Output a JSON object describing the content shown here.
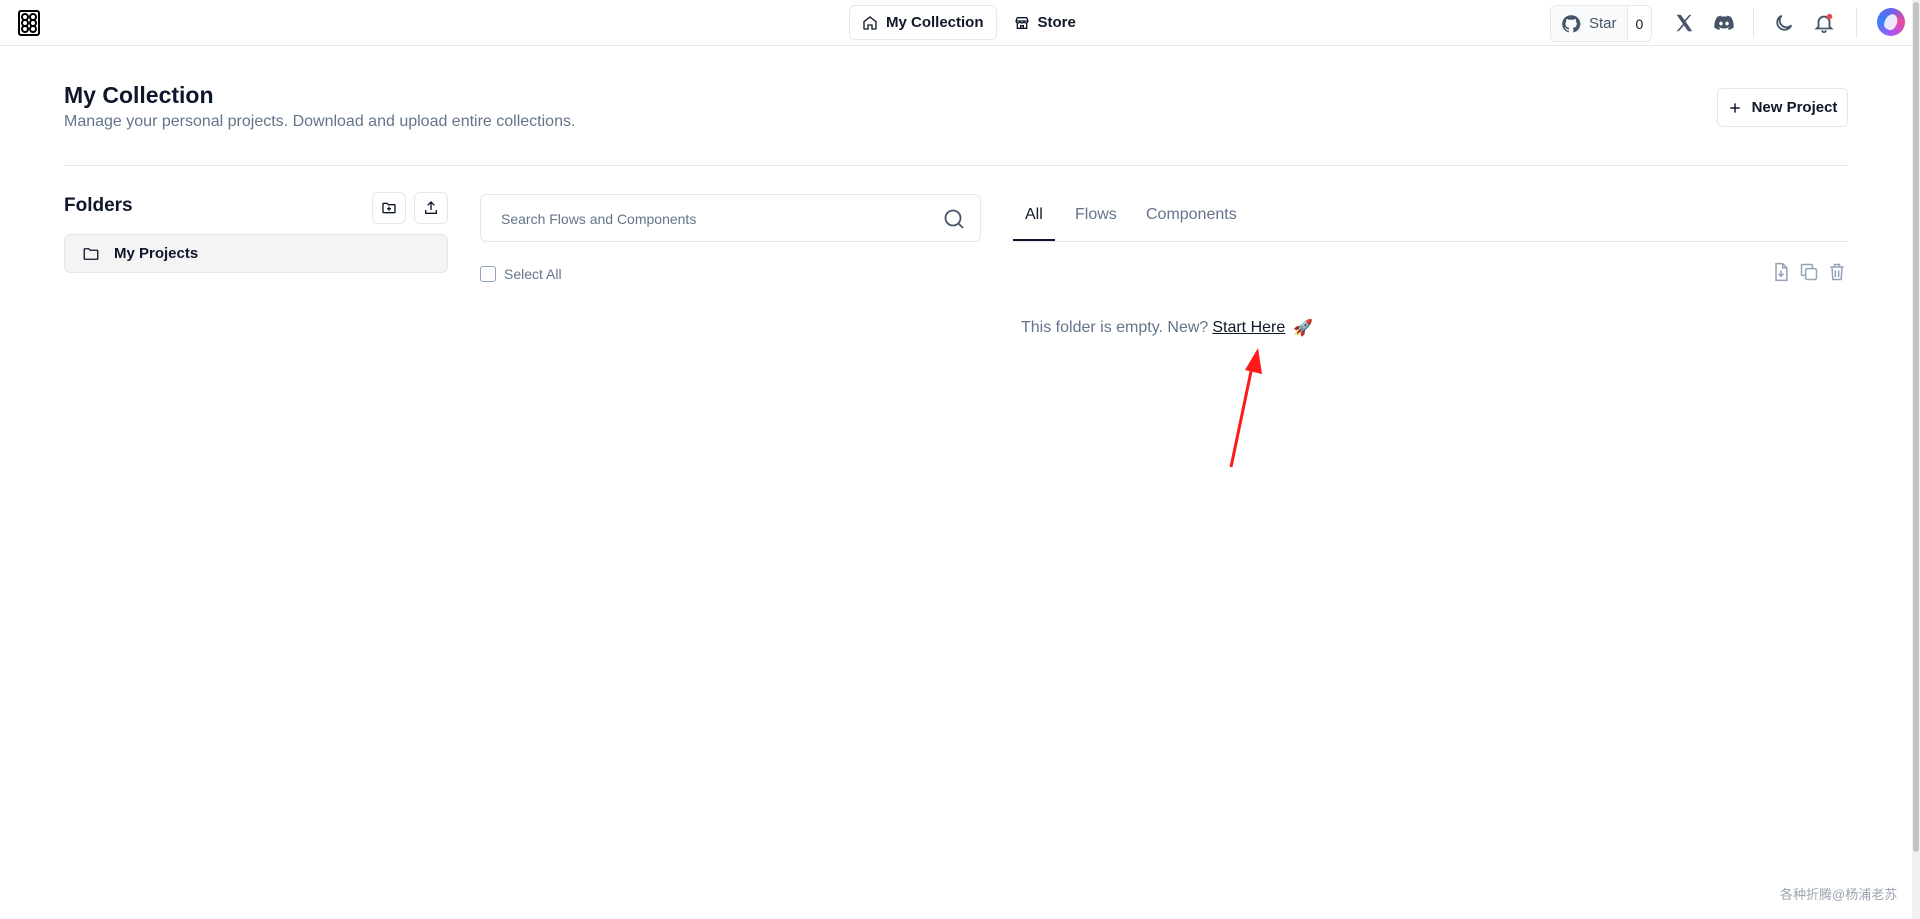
{
  "header": {
    "nav": [
      {
        "label": "My Collection",
        "icon": "home-icon",
        "active": true
      },
      {
        "label": "Store",
        "icon": "store-icon",
        "active": false
      }
    ],
    "github": {
      "label": "Star",
      "count": "0"
    }
  },
  "page": {
    "title": "My Collection",
    "subtitle": "Manage your personal projects. Download and upload entire collections.",
    "new_project_label": "New Project"
  },
  "folders": {
    "title": "Folders",
    "items": [
      {
        "label": "My Projects"
      }
    ]
  },
  "search": {
    "placeholder": "Search Flows and Components"
  },
  "select_all_label": "Select All",
  "tabs": [
    {
      "label": "All",
      "active": true
    },
    {
      "label": "Flows",
      "active": false
    },
    {
      "label": "Components",
      "active": false
    }
  ],
  "empty": {
    "text": "This folder is empty. New?",
    "link": "Start Here",
    "emoji": "🚀"
  },
  "watermark": "各种折腾@杨浦老苏",
  "colors": {
    "annotation_arrow": "#ff1a1a",
    "text_primary": "#0f172a",
    "text_muted": "#64748b",
    "border": "#e5e7eb"
  }
}
